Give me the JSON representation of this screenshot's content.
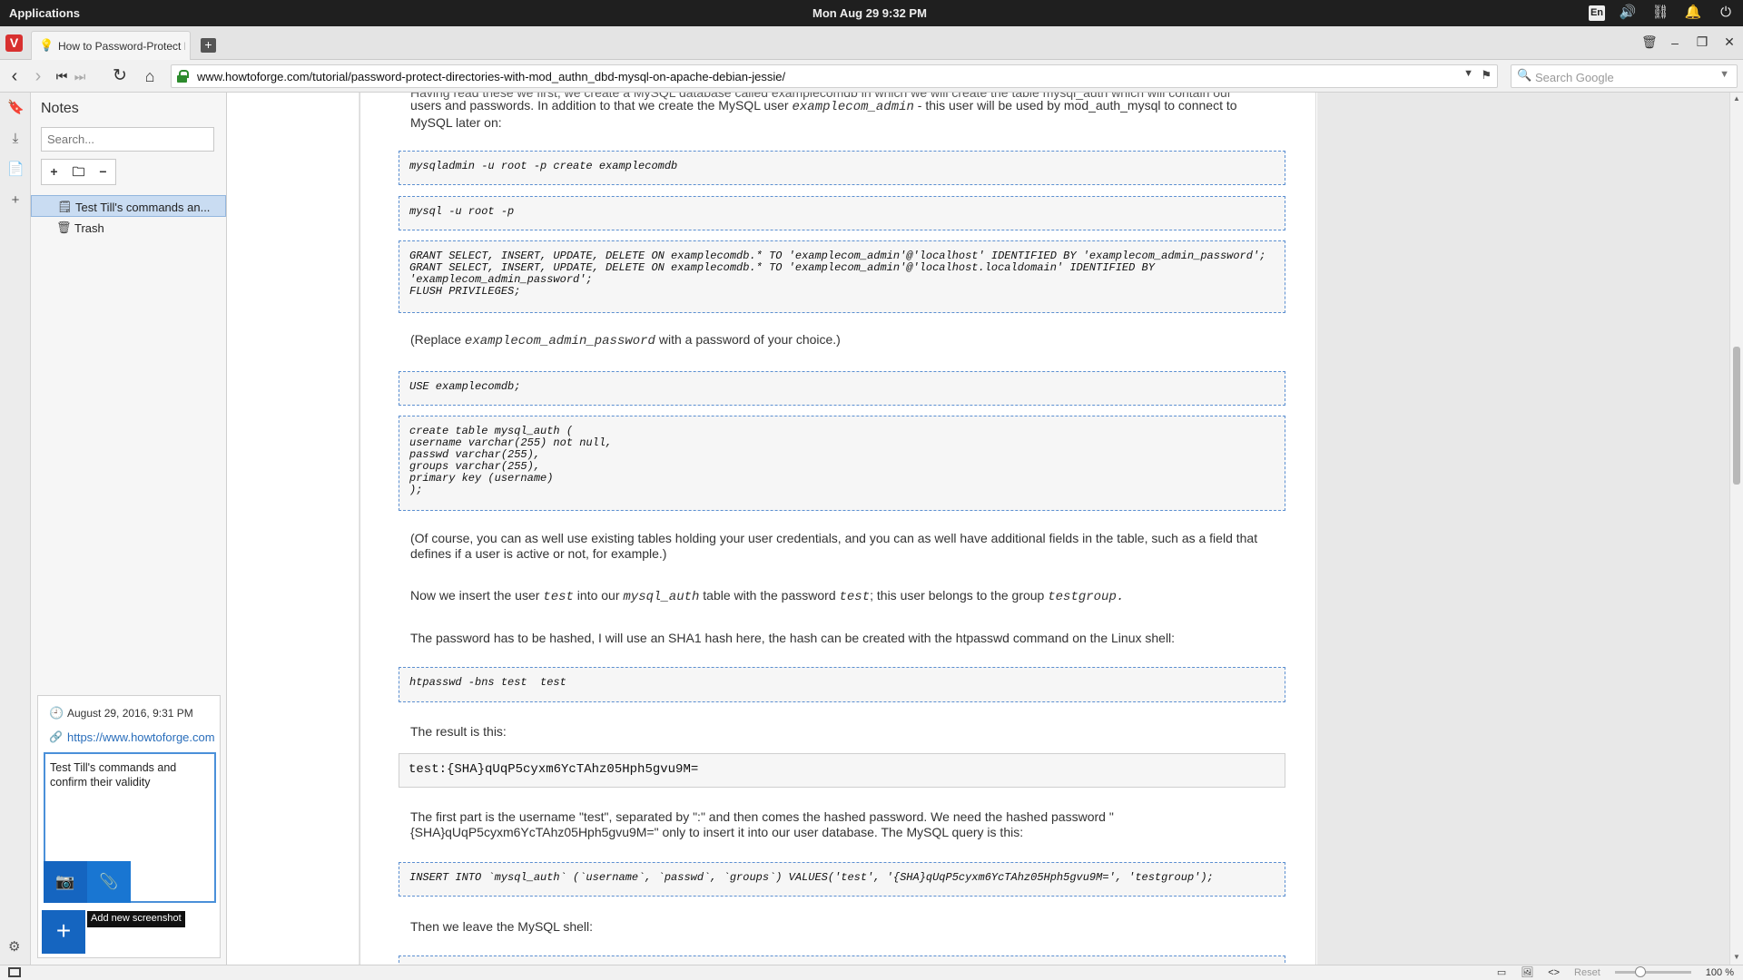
{
  "topbar": {
    "applications": "Applications",
    "clock": "Mon Aug 29    9:32 PM",
    "lang": "En"
  },
  "tab": {
    "title": "How to Password-Protect D",
    "new_tab_symbol": "+"
  },
  "address": {
    "url": "www.howtoforge.com/tutorial/password-protect-directories-with-mod_authn_dbd-mysql-on-apache-debian-jessie/",
    "search_placeholder": "Search Google"
  },
  "notes": {
    "title": "Notes",
    "search_placeholder": "Search...",
    "tools": [
      "+",
      "🗀",
      "−"
    ],
    "items": [
      {
        "label": "Test Till's commands an...",
        "icon": "note-icon",
        "selected": true
      },
      {
        "label": "Trash",
        "icon": "trash-icon",
        "selected": false
      }
    ],
    "detail": {
      "date": "August 29, 2016, 9:31 PM",
      "link": "https://www.howtoforge.com/tutorial/password-protect-directories",
      "text": "Test Till's commands and confirm their validity",
      "tooltip": "Add new screenshot"
    }
  },
  "article": {
    "intro_line1": "Having read these we first, we create a MySQL database called examplecomdb in which we will create the table mysql_auth which will contain our",
    "intro_line2_a": "users and passwords. In addition to that we create the MySQL user ",
    "intro_line2_code": "examplecom_admin",
    "intro_line2_b": " - this user will be used by mod_auth_mysql to connect to",
    "intro_line3": "MySQL later on:",
    "code1": "mysqladmin -u root -p create examplecomdb",
    "code2": "mysql -u root -p",
    "code3": "GRANT SELECT, INSERT, UPDATE, DELETE ON examplecomdb.* TO 'examplecom_admin'@'localhost' IDENTIFIED BY 'examplecom_admin_password';\nGRANT SELECT, INSERT, UPDATE, DELETE ON examplecomdb.* TO 'examplecom_admin'@'localhost.localdomain' IDENTIFIED BY\n'examplecom_admin_password';\nFLUSH PRIVILEGES;",
    "replace_a": "(Replace ",
    "replace_code": "examplecom_admin_password",
    "replace_b": " with a password of your choice.)",
    "code4": "USE examplecomdb;",
    "code5": "create table mysql_auth (\nusername varchar(255) not null,\npasswd varchar(255),\ngroups varchar(255),\nprimary key (username)\n);",
    "ofcourse": "(Of course, you can as well use existing tables holding your user credentials, and you can as well have additional fields in the table, such as a field that defines if a user is active or not, for example.)",
    "insert_a": "Now we insert the user ",
    "insert_code1": "test",
    "insert_b": " into our ",
    "insert_code2": "mysql_auth",
    "insert_c": " table with the password ",
    "insert_code3": "test",
    "insert_d": "; this user belongs to the group ",
    "insert_code4": "testgroup.",
    "hash_para": "The password has to be hashed, I will use an SHA1 hash here, the hash can be created with the htpasswd command on the Linux shell:",
    "code6": "htpasswd -bns test  test",
    "result": "The result is this:",
    "code7": "test:{SHA}qUqP5cyxm6YcTAhz05Hph5gvu9M=",
    "firstpart": "The first part is the username \"test\", separated by \":\" and then comes the hashed password. We need the hashed password \"{SHA}qUqP5cyxm6YcTAhz05Hph5gvu9M=\" only to insert it into our user database. The MySQL query is this:",
    "code8": "INSERT INTO `mysql_auth` (`username`, `passwd`, `groups`) VALUES('test', '{SHA}qUqP5cyxm6YcTAhz05Hph5gvu9M=', 'testgroup');",
    "leave": "Then we leave the MySQL shell:"
  },
  "status": {
    "reset": "Reset",
    "zoom": "100 %"
  }
}
